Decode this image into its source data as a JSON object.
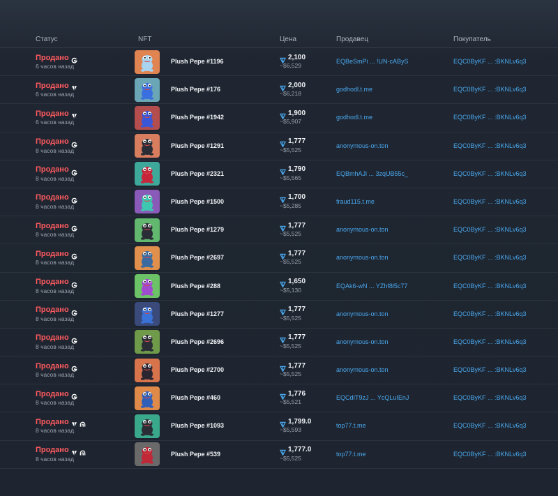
{
  "headers": {
    "status": "Статус",
    "nft": "NFT",
    "price": "Цена",
    "seller": "Продавец",
    "buyer": "Покупатель"
  },
  "colors": {
    "sold": "#ff5a5f",
    "link": "#4aa8ee",
    "muted": "#9aa3af"
  },
  "rows": [
    {
      "status": "Продано",
      "market": "getgems-icon",
      "time": "6 часов назад",
      "name": "Plush Pepe #1196",
      "ton": "2,100",
      "usd": "~$6,529",
      "seller": "EQBeSmPi ... !UN-cAByS",
      "buyer": "EQC0ByKF ... :BKNLv6q3",
      "color": "#e08452",
      "figure": "#a8d4f0"
    },
    {
      "status": "Продано",
      "market": "fragment-icon",
      "time": "6 часов назад",
      "name": "Plush Pepe #176",
      "ton": "2,000",
      "usd": "~$6,218",
      "seller": "godhodl.t.me",
      "buyer": "EQC0ByKF ... :BKNLv6q3",
      "color": "#6aa6b5",
      "figure": "#3a6fe0"
    },
    {
      "status": "Продано",
      "market": "fragment-icon",
      "time": "6 часов назад",
      "name": "Plush Pepe #1942",
      "ton": "1,900",
      "usd": "~$5,907",
      "seller": "godhodl.t.me",
      "buyer": "EQC0ByKF ... :BKNLv6q3",
      "color": "#b44d4d",
      "figure": "#3a56d8"
    },
    {
      "status": "Продано",
      "market": "getgems-icon",
      "time": "8 часов назад",
      "name": "Plush Pepe #1291",
      "ton": "1,777",
      "usd": "~$5,525",
      "seller": "anonymous-on.ton",
      "buyer": "EQC0ByKF ... :BKNLv6q3",
      "color": "#d87d5e",
      "figure": "#2a2d36"
    },
    {
      "status": "Продано",
      "market": "getgems-icon",
      "time": "8 часов назад",
      "name": "Plush Pepe #2321",
      "ton": "1,790",
      "usd": "~$5,565",
      "seller": "EQBmhAJi ... 3zqUB55c_",
      "buyer": "EQC0ByKF ... :BKNLv6q3",
      "color": "#3ea89a",
      "figure": "#c7263a"
    },
    {
      "status": "Продано",
      "market": "getgems-icon",
      "time": "8 часов назад",
      "name": "Plush Pepe #1500",
      "ton": "1,700",
      "usd": "~$5,285",
      "seller": "fraud115.t.me",
      "buyer": "EQC0ByKF ... :BKNLv6q3",
      "color": "#8a5ab8",
      "figure": "#3fc6b0"
    },
    {
      "status": "Продано",
      "market": "getgems-icon",
      "time": "8 часов назад",
      "name": "Plush Pepe #1279",
      "ton": "1,777",
      "usd": "~$5,525",
      "seller": "anonymous-on.ton",
      "buyer": "EQC0ByKF ... :BKNLv6q3",
      "color": "#62b86e",
      "figure": "#2a2d36"
    },
    {
      "status": "Продано",
      "market": "getgems-icon",
      "time": "8 часов назад",
      "name": "Plush Pepe #2697",
      "ton": "1,777",
      "usd": "~$5,525",
      "seller": "anonymous-on.ton",
      "buyer": "EQC0ByKF ... :BKNLv6q3",
      "color": "#e0904c",
      "figure": "#3a6aa0"
    },
    {
      "status": "Продано",
      "market": "getgems-icon",
      "time": "8 часов назад",
      "name": "Plush Pepe #288",
      "ton": "1,650",
      "usd": "~$5,130",
      "seller": "EQAk6-wN ... YZhf8l5c77",
      "buyer": "EQC0ByKF ... :BKNLv6q3",
      "color": "#6cc266",
      "figure": "#a04ad0"
    },
    {
      "status": "Продано",
      "market": "getgems-icon",
      "time": "8 часов назад",
      "name": "Plush Pepe #1277",
      "ton": "1,777",
      "usd": "~$5,525",
      "seller": "anonymous-on.ton",
      "buyer": "EQC0ByKF ... :BKNLv6q3",
      "color": "#3a4a7a",
      "figure": "#3a72d8"
    },
    {
      "status": "Продано",
      "market": "getgems-icon",
      "time": "8 часов назад",
      "name": "Plush Pepe #2696",
      "ton": "1,777",
      "usd": "~$5,525",
      "seller": "anonymous-on.ton",
      "buyer": "EQC0ByKF ... :BKNLv6q3",
      "color": "#6e9a4a",
      "figure": "#2a2d36"
    },
    {
      "status": "Продано",
      "market": "getgems-icon",
      "time": "8 часов назад",
      "name": "Plush Pepe #2700",
      "ton": "1,777",
      "usd": "~$5,525",
      "seller": "anonymous-on.ton",
      "buyer": "EQC0ByKF ... :BKNLv6q3",
      "color": "#d8744c",
      "figure": "#2a2530"
    },
    {
      "status": "Продано",
      "market": "getgems-icon",
      "time": "8 часов назад",
      "name": "Plush Pepe #460",
      "ton": "1,776",
      "usd": "~$5,521",
      "seller": "EQCdIT9zJ ... YcQLuIEnJ",
      "buyer": "EQC0ByKF ... :BKNLv6q3",
      "color": "#e08a4a",
      "figure": "#2f5fb8"
    },
    {
      "status": "Продано",
      "market": "fragment-icon",
      "market2": "portals-icon",
      "time": "8 часов назад",
      "name": "Plush Pepe #1093",
      "ton": "1,799.0",
      "usd": "~$5,593",
      "seller": "top77.t.me",
      "buyer": "EQC0ByKF ... :BKNLv6q3",
      "color": "#3aa88a",
      "figure": "#2a2d36"
    },
    {
      "status": "Продано",
      "market": "fragment-icon",
      "market2": "portals-icon",
      "time": "8 часов назад",
      "name": "Plush Pepe #539",
      "ton": "1,777.0",
      "usd": "~$5,525",
      "seller": "top77.t.me",
      "buyer": "EQC0ByKF ... :BKNLv6q3",
      "color": "#6a6a6a",
      "figure": "#c02838"
    }
  ]
}
